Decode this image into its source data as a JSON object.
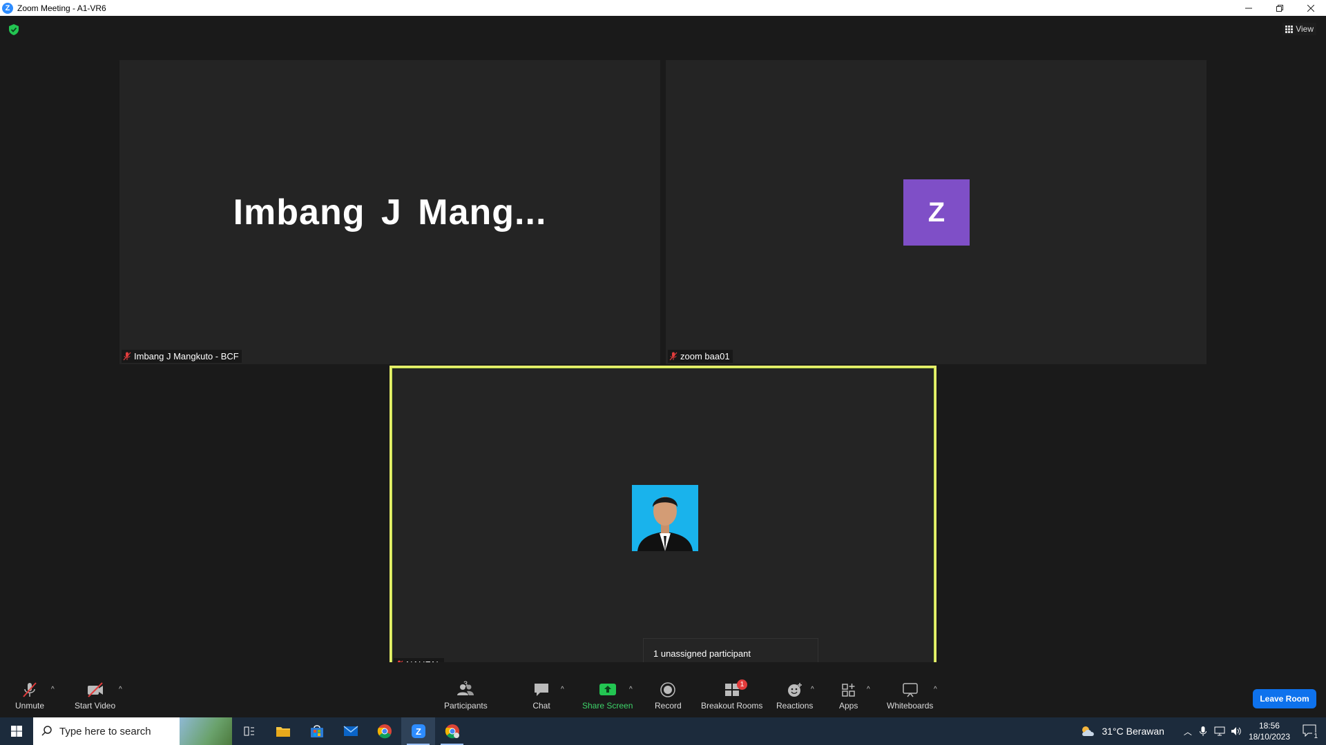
{
  "window": {
    "title": "Zoom Meeting - A1-VR6",
    "logo_letter": "Z"
  },
  "header": {
    "view_label": "View"
  },
  "tiles": [
    {
      "display_text": "Imbang  J  Mang...",
      "name_label": "Imbang J Mangkuto - BCF"
    },
    {
      "avatar_letter": "Z",
      "avatar_color": "#7f4fc7",
      "name_label": "zoom baa01"
    },
    {
      "name_label": "NAUFAL",
      "active_border_color": "#e7ef6b"
    }
  ],
  "tooltip": {
    "text": "1 unassigned participant"
  },
  "toolbar": {
    "unmute": "Unmute",
    "start_video": "Start Video",
    "participants": "Participants",
    "participants_count": "3",
    "chat": "Chat",
    "share_screen": "Share Screen",
    "record": "Record",
    "breakout_rooms": "Breakout Rooms",
    "breakout_badge": "1",
    "reactions": "Reactions",
    "apps": "Apps",
    "whiteboards": "Whiteboards",
    "leave_room": "Leave Room"
  },
  "taskbar": {
    "search_placeholder": "Type here to search",
    "weather": "31°C  Berawan",
    "time": "18:56",
    "date": "18/10/2023",
    "notification_count": "1"
  },
  "colors": {
    "accent_blue": "#0e72ed",
    "share_green": "#3ed46a",
    "badge_red": "#e23c3c"
  }
}
